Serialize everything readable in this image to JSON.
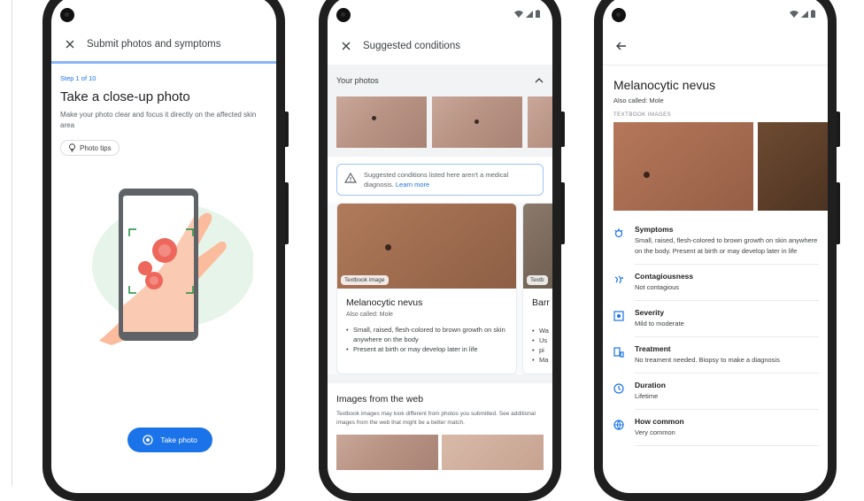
{
  "phone1": {
    "appbar_title": "Submit photos and symptoms",
    "step": "Step 1 of 10",
    "heading": "Take a close-up photo",
    "description": "Make your photo clear and focus it directly on the affected skin area",
    "tip_chip": "Photo tips",
    "take_photo": "Take photo"
  },
  "phone2": {
    "appbar_title": "Suggested conditions",
    "your_photos": "Your photos",
    "alert_text": "Suggested conditions listed here aren't a medical diagnosis.",
    "alert_link": "Learn more",
    "card1": {
      "tag": "Textbook image",
      "title": "Melanocytic nevus",
      "aka": "Also called: Mole",
      "bullets": [
        "Small, raised, flesh-colored to brown growth on skin anywhere on the body",
        "Present at birth or may develop later in life"
      ]
    },
    "card2": {
      "tag": "Textb",
      "title": "Barr",
      "bullet_starts": [
        "Wa",
        "Us",
        "pi",
        "Ma"
      ]
    },
    "web_title": "Images from the web",
    "web_desc": "Textbook images may look different from photos you submitted. See additional images from the web that might be a better match."
  },
  "phone3": {
    "title": "Melanocytic nevus",
    "aka": "Also called: Mole",
    "textbook_label": "TEXTBOOK IMAGES",
    "rows": [
      {
        "title": "Symptoms",
        "value": "Small, raised, flesh-colored to brown growth on skin anywhere on the body. Present at birth or may develop later in life",
        "icon": "symptoms-icon"
      },
      {
        "title": "Contagiousness",
        "value": "Not contagious",
        "icon": "contagious-icon"
      },
      {
        "title": "Severity",
        "value": "Mild to moderate",
        "icon": "severity-icon"
      },
      {
        "title": "Treatment",
        "value": "No treament needed. Biopsy to make a diagnosis",
        "icon": "treatment-icon"
      },
      {
        "title": "Duration",
        "value": "Lifetime",
        "icon": "clock-icon"
      },
      {
        "title": "How common",
        "value": "Very common",
        "icon": "globe-icon"
      }
    ]
  },
  "colors": {
    "accent": "#1a73e8",
    "progress": "#8ab4f8"
  }
}
